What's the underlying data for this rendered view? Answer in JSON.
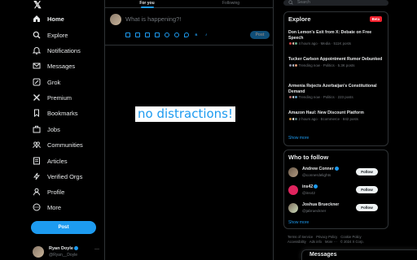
{
  "nav": {
    "logo": "𝕏",
    "items": [
      {
        "label": "Home",
        "icon": "home-icon",
        "active": true
      },
      {
        "label": "Explore",
        "icon": "search-icon"
      },
      {
        "label": "Notifications",
        "icon": "bell-icon"
      },
      {
        "label": "Messages",
        "icon": "mail-icon"
      },
      {
        "label": "Grok",
        "icon": "grok-icon"
      },
      {
        "label": "Premium",
        "icon": "x-logo-icon"
      },
      {
        "label": "Bookmarks",
        "icon": "bookmark-icon"
      },
      {
        "label": "Jobs",
        "icon": "briefcase-icon"
      },
      {
        "label": "Communities",
        "icon": "people-icon"
      },
      {
        "label": "Articles",
        "icon": "document-icon"
      },
      {
        "label": "Verified Orgs",
        "icon": "lightning-icon"
      },
      {
        "label": "Profile",
        "icon": "person-icon"
      },
      {
        "label": "More",
        "icon": "more-circle-icon"
      }
    ],
    "post_label": "Post",
    "user": {
      "name": "Ryan Doyle",
      "handle": "@Ryan__Doyle",
      "more": "···"
    }
  },
  "center": {
    "tabs": [
      {
        "label": "For you",
        "active": true
      },
      {
        "label": "Following"
      }
    ],
    "compose_placeholder": "What is happening?!",
    "post_label": "Post",
    "tools": [
      "image-icon",
      "gif-icon",
      "list-icon",
      "poll-icon",
      "emoji-icon",
      "schedule-icon",
      "location-icon",
      "bold-icon",
      "italic-icon"
    ],
    "overlay_text": "no distractions!"
  },
  "right": {
    "search_placeholder": "Search",
    "explore": {
      "title": "Explore",
      "badge": "Beta",
      "stories": [
        {
          "title": "Don Lemon's Exit from X: Debate on Free Speech",
          "meta": "4 hours ago · Media · 511K posts"
        },
        {
          "title": "Tucker Carlson Appointment Rumor Debunked",
          "meta": "Trending now · Politics · 5.3K posts"
        },
        {
          "title": "Armenia Rejects Azerbaijan's Constitutional Demand",
          "meta": "Trending now · Politics · 223 posts"
        },
        {
          "title": "Amazon Haul: New Discount Platform",
          "meta": "2 hours ago · Ecommerce · 842 posts"
        }
      ],
      "show_more": "Show more"
    },
    "who_to_follow": {
      "title": "Who to follow",
      "accounts": [
        {
          "name": "Andrew Conner",
          "handle": "@connerdelights",
          "button": "Follow"
        },
        {
          "name": "ins42",
          "handle": "@ins42",
          "button": "Follow"
        },
        {
          "name": "Joshua Brueckner",
          "handle": "@jabrueckner",
          "button": "Follow"
        }
      ],
      "show_more": "Show more"
    },
    "footer": [
      "Terms of Service",
      "Privacy Policy",
      "Cookie Policy",
      "Accessibility",
      "Ads info",
      "More ···",
      "© 2024 X Corp."
    ],
    "messages_label": "Messages"
  },
  "colors": {
    "accent": "#1d9bf0",
    "background": "#000000",
    "border": "#2f3336",
    "muted": "#71767b",
    "beta": "#f4212e"
  }
}
